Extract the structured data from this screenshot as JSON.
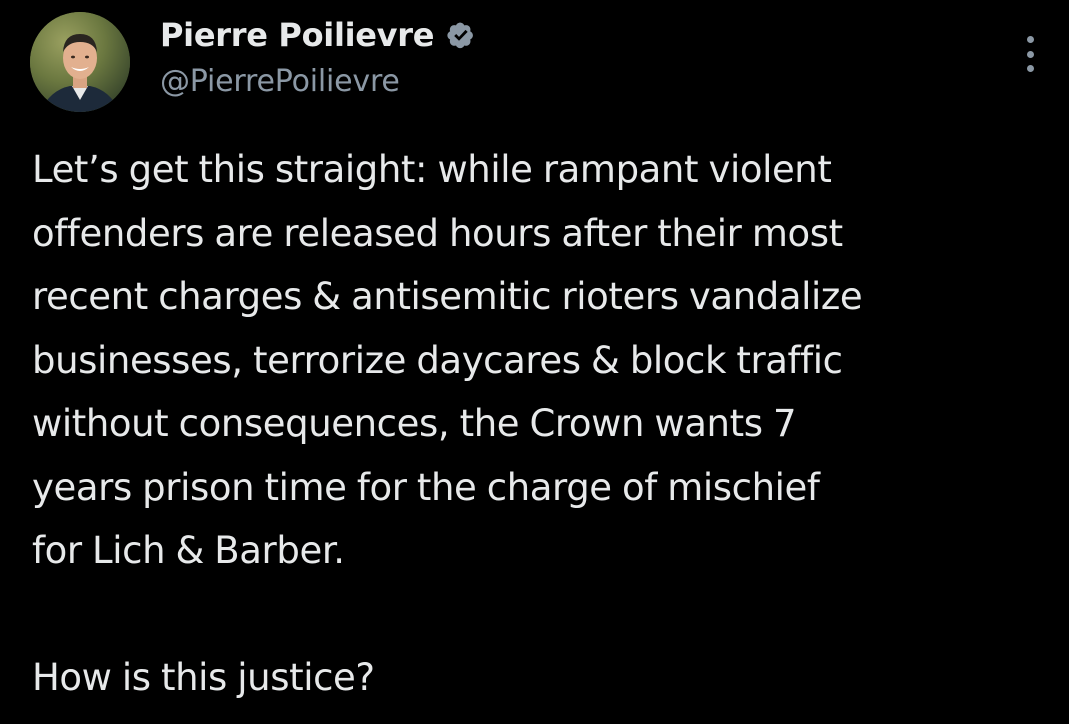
{
  "author": {
    "display_name": "Pierre Poilievre",
    "handle": "@PierrePoilievre",
    "avatar_icon": "profile-photo",
    "verified_icon": "verified-badge-icon",
    "verified_color": "#8b98a5"
  },
  "actions": {
    "more_icon": "more-vertical-icon"
  },
  "tweet": {
    "text": "Let’s get this straight: while rampant violent\noffenders are released hours after their most\nrecent charges & antisemitic rioters vandalize\nbusinesses, terrorize daycares & block traffic\nwithout consequences, the Crown wants 7\nyears prison time for the charge of mischief\nfor Lich & Barber.\n\nHow is this justice?"
  },
  "colors": {
    "background": "#000000",
    "primary_text": "#e7e9ea",
    "secondary_text": "#8b98a5"
  }
}
